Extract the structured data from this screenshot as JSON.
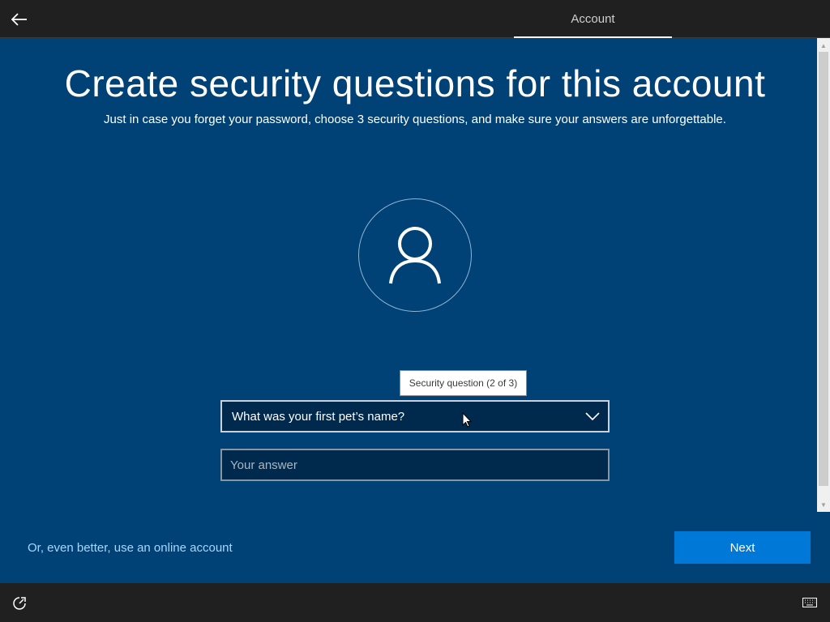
{
  "header": {
    "step_label": "Account"
  },
  "main": {
    "title": "Create security questions for this account",
    "subtitle": "Just in case you forget your password, choose 3 security questions, and make sure your answers are unforgettable.",
    "tooltip": "Security question (2 of 3)",
    "question_select": {
      "value": "What was your first pet’s name?"
    },
    "answer_input": {
      "placeholder": "Your answer",
      "value": ""
    }
  },
  "footer": {
    "online_account_link": "Or, even better, use an online account",
    "next_label": "Next"
  },
  "icons": {
    "back": "back-arrow-icon",
    "avatar": "user-icon",
    "chevron": "chevron-down-icon",
    "ease_of_access": "ease-of-access-icon",
    "keyboard": "keyboard-icon"
  },
  "colors": {
    "background": "#004275",
    "topbar": "#202020",
    "accent": "#0078d7",
    "link": "#a8d6ff",
    "field_bg": "#002a4d"
  }
}
